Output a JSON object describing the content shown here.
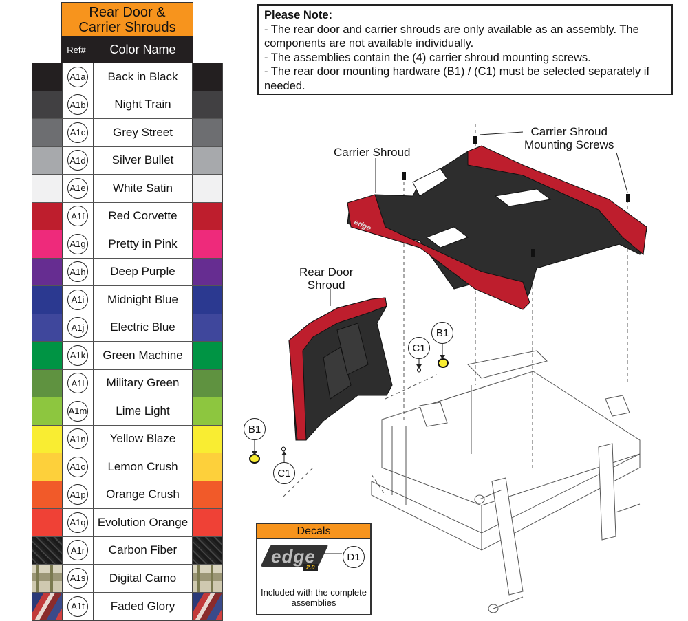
{
  "table": {
    "title_line1": "Rear Door &",
    "title_line2": "Carrier Shrouds",
    "col_ref": "Ref#",
    "col_name": "Color Name",
    "rows": [
      {
        "ref": "A1a",
        "name": "Back in Black",
        "color": "#231f20"
      },
      {
        "ref": "A1b",
        "name": "Night Train",
        "color": "#414042"
      },
      {
        "ref": "A1c",
        "name": "Grey Street",
        "color": "#6d6e71"
      },
      {
        "ref": "A1d",
        "name": "Silver Bullet",
        "color": "#a7a9ac"
      },
      {
        "ref": "A1e",
        "name": "White Satin",
        "color": "#f1f1f2"
      },
      {
        "ref": "A1f",
        "name": "Red Corvette",
        "color": "#be1e2d"
      },
      {
        "ref": "A1g",
        "name": "Pretty in Pink",
        "color": "#ee2a7b"
      },
      {
        "ref": "A1h",
        "name": "Deep Purple",
        "color": "#662d91"
      },
      {
        "ref": "A1i",
        "name": "Midnight Blue",
        "color": "#2b3990"
      },
      {
        "ref": "A1j",
        "name": "Electric Blue",
        "color": "#3f479c"
      },
      {
        "ref": "A1k",
        "name": "Green Machine",
        "color": "#009444"
      },
      {
        "ref": "A1l",
        "name": "Military Green",
        "color": "#5f9240"
      },
      {
        "ref": "A1m",
        "name": "Lime Light",
        "color": "#8dc63f"
      },
      {
        "ref": "A1n",
        "name": "Yellow Blaze",
        "color": "#f9ed32"
      },
      {
        "ref": "A1o",
        "name": "Lemon Crush",
        "color": "#fdd03b"
      },
      {
        "ref": "A1p",
        "name": "Orange Crush",
        "color": "#f15a29"
      },
      {
        "ref": "A1q",
        "name": "Evolution Orange",
        "color": "#ef4136"
      },
      {
        "ref": "A1r",
        "name": "Carbon Fiber",
        "pattern": "carbon"
      },
      {
        "ref": "A1s",
        "name": "Digital Camo",
        "pattern": "camo"
      },
      {
        "ref": "A1t",
        "name": "Faded Glory",
        "pattern": "glory"
      }
    ]
  },
  "note": {
    "heading": "Please Note:",
    "line1": "- The rear door and carrier shrouds are only available as an assembly. The components are not available individually.",
    "line2": "- The assemblies contain the (4) carrier shroud mounting screws.",
    "line3": "- The rear door mounting hardware (B1) / (C1) must be selected separately if needed."
  },
  "diagram": {
    "label_carrier_shroud": "Carrier Shroud",
    "label_screws_line1": "Carrier Shroud",
    "label_screws_line2": "Mounting Screws",
    "label_rear_door_line1": "Rear Door",
    "label_rear_door_line2": "Shroud",
    "callout_b1": "B1",
    "callout_c1": "C1",
    "shroud_color": "#be1e2d",
    "plastic_color": "#2d2d2d"
  },
  "decals": {
    "title": "Decals",
    "logo_text": "edge",
    "logo_version": "2.0",
    "callout": "D1",
    "caption": "Included with the complete assemblies"
  },
  "accent_color": "#f7941d"
}
